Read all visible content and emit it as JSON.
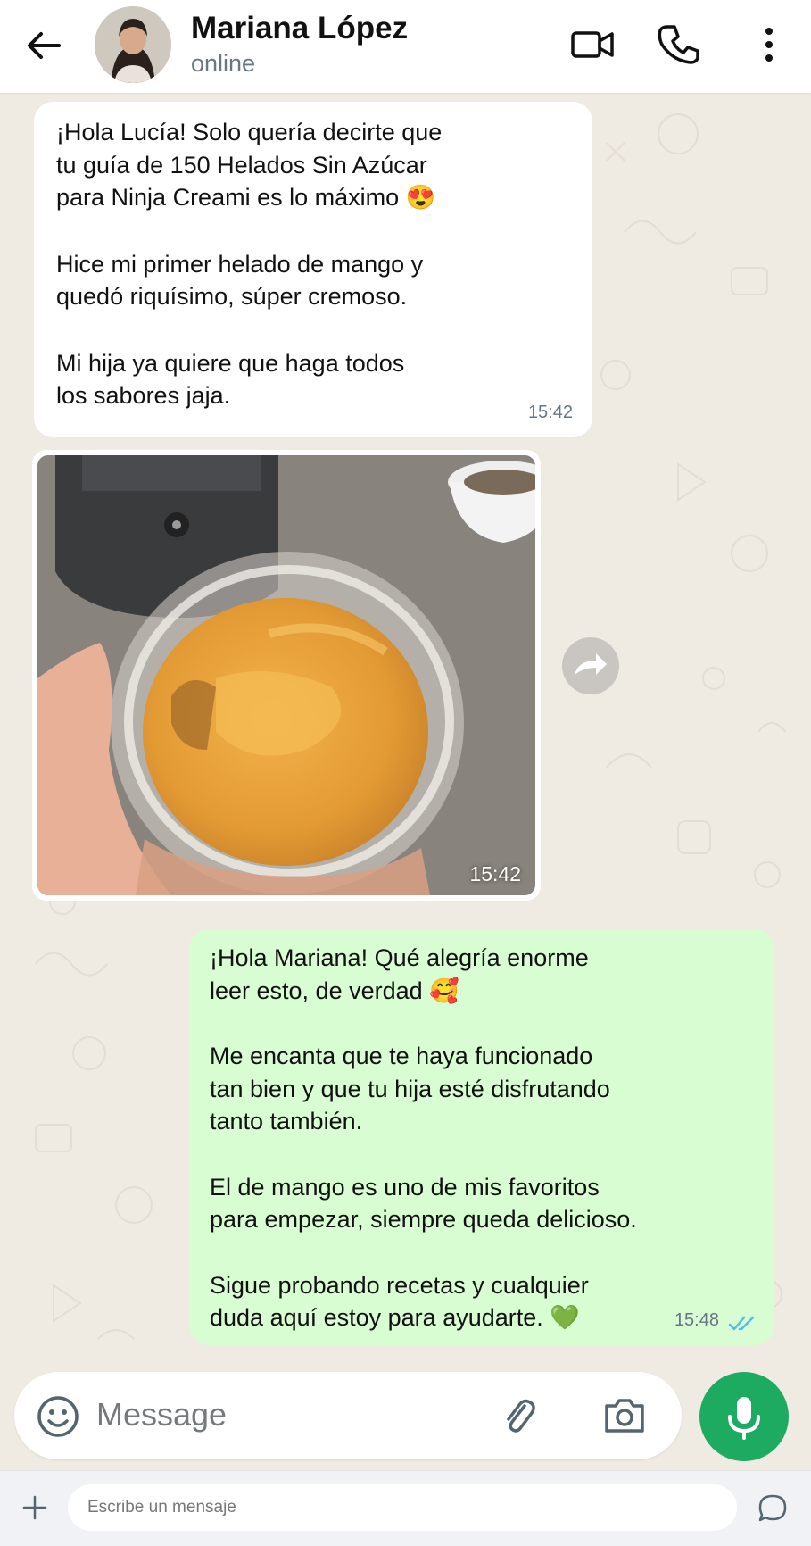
{
  "header": {
    "contact_name": "Mariana López",
    "status": "online",
    "icons": [
      "back-arrow-icon",
      "video-call-icon",
      "voice-call-icon",
      "more-options-icon"
    ]
  },
  "messages": [
    {
      "direction": "incoming",
      "paragraphs": [
        [
          "¡Hola Lucía! Solo quería decirte que",
          "tu guía de 150 Helados Sin Azúcar",
          "para Ninja Creami es lo máximo 😍"
        ],
        [
          "Hice mi primer helado de mango y",
          "quedó riquísimo, súper cremoso."
        ],
        [
          "Mi hija ya quiere que haga todos",
          "los sabores jaja."
        ]
      ],
      "time": "15:42"
    },
    {
      "direction": "incoming",
      "type": "image",
      "image_description_icon": "mango-ice-cream-photo",
      "time": "15:42"
    },
    {
      "direction": "outgoing",
      "paragraphs": [
        [
          "¡Hola Mariana! Qué alegría enorme",
          "leer esto, de verdad 🥰"
        ],
        [
          "Me encanta que te haya funcionado",
          "tan bien y que tu hija esté disfrutando",
          "tanto también."
        ],
        [
          "El de mango es uno de mis favoritos",
          "para empezar, siempre queda delicioso."
        ],
        [
          "Sigue probando recetas y cualquier",
          "duda aquí estoy para ayudarte. 💚"
        ]
      ],
      "time": "15:48",
      "status": "read"
    }
  ],
  "composer": {
    "placeholder": "Message",
    "icons": [
      "emoji-icon",
      "attach-icon",
      "camera-icon",
      "mic-icon"
    ]
  },
  "bottom_bar": {
    "placeholder": "Escribe un mensaje",
    "icons": [
      "plus-icon",
      "chat-bubble-icon"
    ]
  },
  "colors": {
    "incoming_bubble": "#ffffff",
    "outgoing_bubble": "#d9fdd3",
    "wallpaper": "#efeae2",
    "accent_green": "#1daa61",
    "read_ticks": "#53bdeb"
  }
}
